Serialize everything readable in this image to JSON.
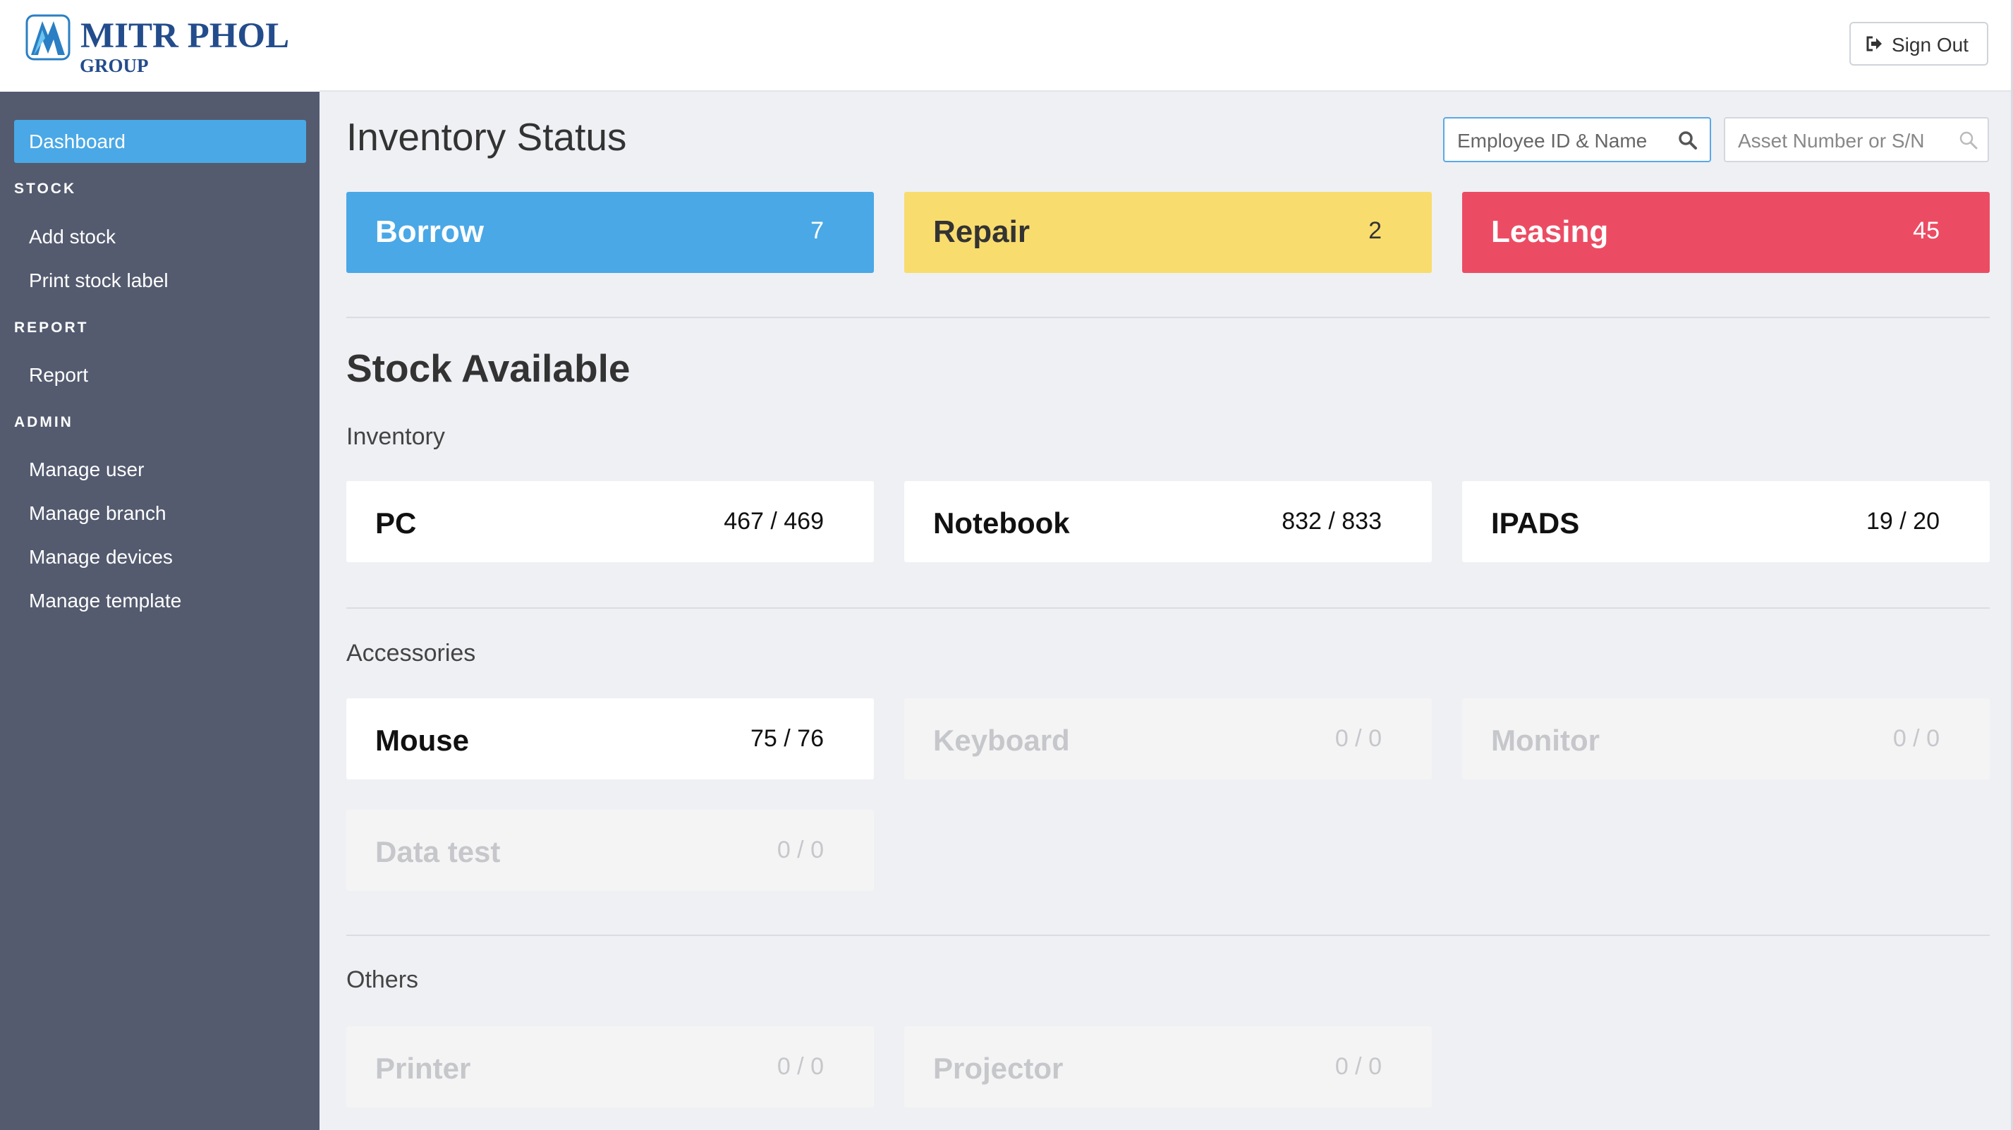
{
  "brand": {
    "name": "MITR PHOL",
    "sub": "GROUP"
  },
  "sidebar": {
    "active_item": "Dashboard",
    "sections": [
      {
        "title": "STOCK",
        "items": [
          "Add stock",
          "Print stock label"
        ]
      },
      {
        "title": "REPORT",
        "items": [
          "Report"
        ]
      },
      {
        "title": "ADMIN",
        "items": [
          "Manage user",
          "Manage branch",
          "Manage devices",
          "Manage template"
        ]
      }
    ]
  },
  "header": {
    "signout_label": "Sign Out",
    "signout_icon": "sign-out-icon"
  },
  "inventory_status": {
    "title": "Inventory Status",
    "search_employee_placeholder": "Employee ID & Name",
    "search_asset_placeholder": "Asset Number or S/N",
    "cards": [
      {
        "label": "Borrow",
        "count": "7",
        "color": "#4aa8e6",
        "text_color": "#ffffff"
      },
      {
        "label": "Repair",
        "count": "2",
        "color": "#f9dc6e",
        "text_color": "#333333"
      },
      {
        "label": "Leasing",
        "count": "45",
        "color": "#ec4c63",
        "text_color": "#ffffff"
      }
    ]
  },
  "stock_available": {
    "title": "Stock Available",
    "groups": [
      {
        "label": "Inventory",
        "items": [
          {
            "name": "PC",
            "count": "467 / 469",
            "enabled": true
          },
          {
            "name": "Notebook",
            "count": "832 / 833",
            "enabled": true
          },
          {
            "name": "IPADS",
            "count": "19 / 20",
            "enabled": true
          }
        ]
      },
      {
        "label": "Accessories",
        "items": [
          {
            "name": "Mouse",
            "count": "75 / 76",
            "enabled": true
          },
          {
            "name": "Keyboard",
            "count": "0 / 0",
            "enabled": false
          },
          {
            "name": "Monitor",
            "count": "0 / 0",
            "enabled": false
          },
          {
            "name": "Data test",
            "count": "0 / 0",
            "enabled": false
          }
        ]
      },
      {
        "label": "Others",
        "items": [
          {
            "name": "Printer",
            "count": "0 / 0",
            "enabled": false
          },
          {
            "name": "Projector",
            "count": "0 / 0",
            "enabled": false
          }
        ]
      }
    ]
  }
}
